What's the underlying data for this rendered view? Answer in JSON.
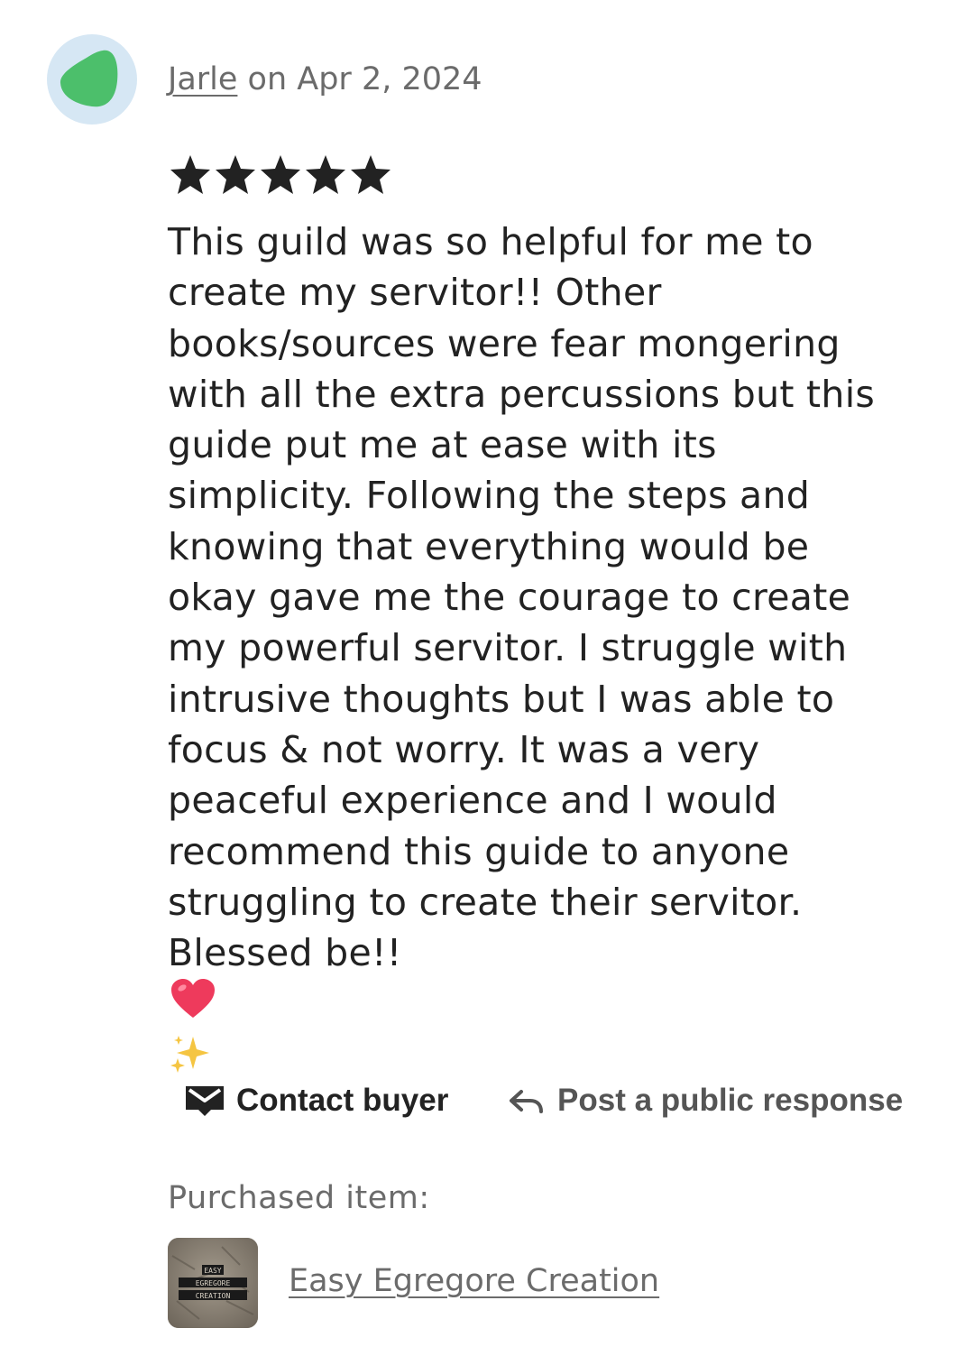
{
  "review": {
    "author": "Jarle",
    "date_text": " on Apr 2, 2024",
    "rating": 5,
    "rating_max": 5,
    "text_lines": [
      "This guild was so helpful for me to",
      "create my servitor!! Other",
      "books/sources were fear mongering",
      "with all the extra percussions but this",
      "guide put me at ease with its",
      "simplicity. Following the steps and",
      "knowing that everything would be",
      "okay gave me the courage to create",
      "my powerful servitor. I struggle with",
      "intrusive thoughts but I was able to",
      "focus & not worry. It was a very",
      "peaceful experience and I would",
      "recommend this guide to anyone",
      "struggling to create their servitor.",
      "Blessed be!!"
    ],
    "emojis": [
      "heart-emoji",
      "sparkles-emoji"
    ]
  },
  "actions": {
    "contact_label": "Contact buyer",
    "contact_icon": "mail-icon",
    "respond_label": "Post a public response",
    "respond_icon": "reply-arrow-icon"
  },
  "purchase": {
    "label": "Purchased item:",
    "item_name": "Easy Egregore Creation",
    "thumbnail_lines": [
      "EASY",
      "EGREGORE",
      "CREATION"
    ]
  },
  "colors": {
    "avatar_bg": "#d6e7f4",
    "avatar_shape": "#4cbf6b",
    "text": "#222222",
    "muted": "#6b6b6b",
    "heart": "#ee3a5c",
    "sparkle": "#f5c542"
  }
}
